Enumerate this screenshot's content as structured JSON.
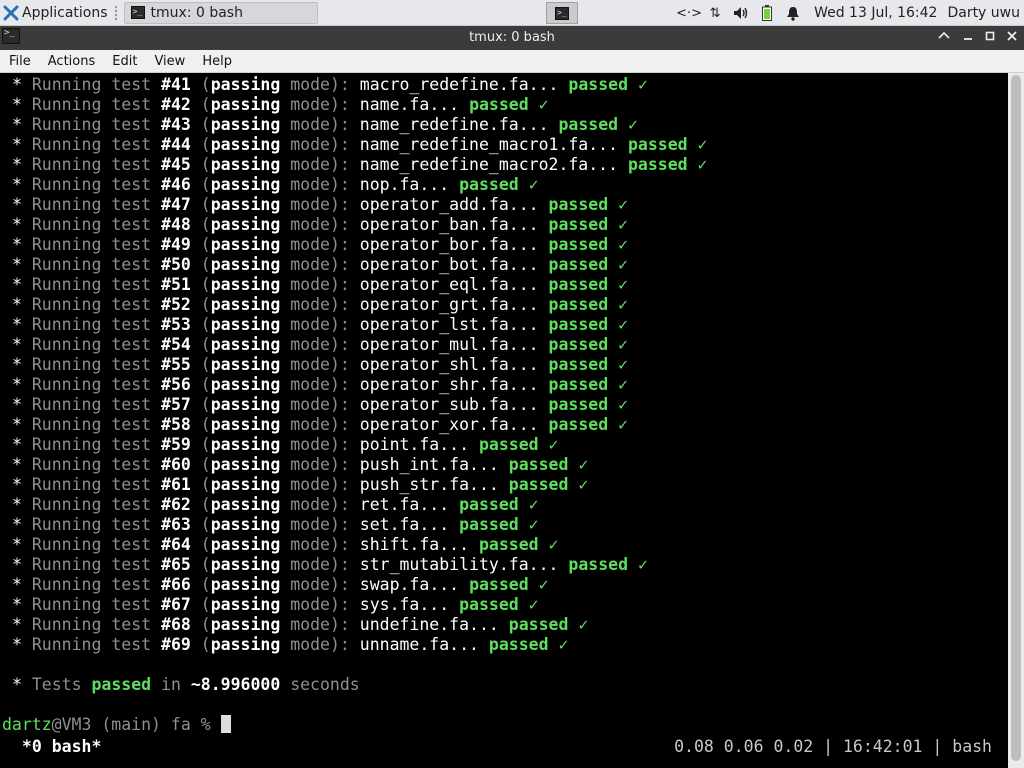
{
  "panel": {
    "applications_label": "Applications",
    "task_label": "tmux: 0 bash",
    "clock": "Wed 13 Jul, 16:42",
    "user": "Darty uwu",
    "tray_icons": [
      "network-arrows-icon",
      "updown-arrows-icon",
      "volume-icon",
      "battery-icon",
      "bell-icon"
    ]
  },
  "window": {
    "title": "tmux: 0 bash",
    "controls": [
      "minimize-up-icon",
      "minimize-icon",
      "maximize-icon",
      "close-icon"
    ]
  },
  "menubar": {
    "items": [
      "File",
      "Actions",
      "Edit",
      "View",
      "Help"
    ]
  },
  "terminal": {
    "prefix_star": "*",
    "prefix_running": "Running test",
    "mode_label": "passing",
    "mode_suffix": "mode",
    "ellipsis": "...",
    "passed_word": "passed",
    "check": "✓",
    "tests": [
      {
        "num": "#41",
        "file": "macro_redefine.fa"
      },
      {
        "num": "#42",
        "file": "name.fa"
      },
      {
        "num": "#43",
        "file": "name_redefine.fa"
      },
      {
        "num": "#44",
        "file": "name_redefine_macro1.fa"
      },
      {
        "num": "#45",
        "file": "name_redefine_macro2.fa"
      },
      {
        "num": "#46",
        "file": "nop.fa"
      },
      {
        "num": "#47",
        "file": "operator_add.fa"
      },
      {
        "num": "#48",
        "file": "operator_ban.fa"
      },
      {
        "num": "#49",
        "file": "operator_bor.fa"
      },
      {
        "num": "#50",
        "file": "operator_bot.fa"
      },
      {
        "num": "#51",
        "file": "operator_eql.fa"
      },
      {
        "num": "#52",
        "file": "operator_grt.fa"
      },
      {
        "num": "#53",
        "file": "operator_lst.fa"
      },
      {
        "num": "#54",
        "file": "operator_mul.fa"
      },
      {
        "num": "#55",
        "file": "operator_shl.fa"
      },
      {
        "num": "#56",
        "file": "operator_shr.fa"
      },
      {
        "num": "#57",
        "file": "operator_sub.fa"
      },
      {
        "num": "#58",
        "file": "operator_xor.fa"
      },
      {
        "num": "#59",
        "file": "point.fa"
      },
      {
        "num": "#60",
        "file": "push_int.fa"
      },
      {
        "num": "#61",
        "file": "push_str.fa"
      },
      {
        "num": "#62",
        "file": "ret.fa"
      },
      {
        "num": "#63",
        "file": "set.fa"
      },
      {
        "num": "#64",
        "file": "shift.fa"
      },
      {
        "num": "#65",
        "file": "str_mutability.fa"
      },
      {
        "num": "#66",
        "file": "swap.fa"
      },
      {
        "num": "#67",
        "file": "sys.fa"
      },
      {
        "num": "#68",
        "file": "undefine.fa"
      },
      {
        "num": "#69",
        "file": "unname.fa"
      }
    ],
    "summary": {
      "star": "*",
      "tests_word": "Tests",
      "passed_word": "passed",
      "in_word": "in",
      "duration": "~8.996000",
      "seconds_word": "seconds"
    },
    "prompt": {
      "user": "dartz",
      "host": "@VM3",
      "branch": "(main)",
      "dir": "fa",
      "symbol": "%"
    }
  },
  "tmux_status": {
    "left": " *0 bash*",
    "right": "0.08 0.06 0.02 | 16:42:01 | bash"
  },
  "colors": {
    "panel_bg": "#e7e8eb",
    "titlebar_bg": "#3b3b3b",
    "terminal_bg": "#000000",
    "passed_green": "#5ee05e",
    "dim_grey": "#8f8f8f"
  }
}
